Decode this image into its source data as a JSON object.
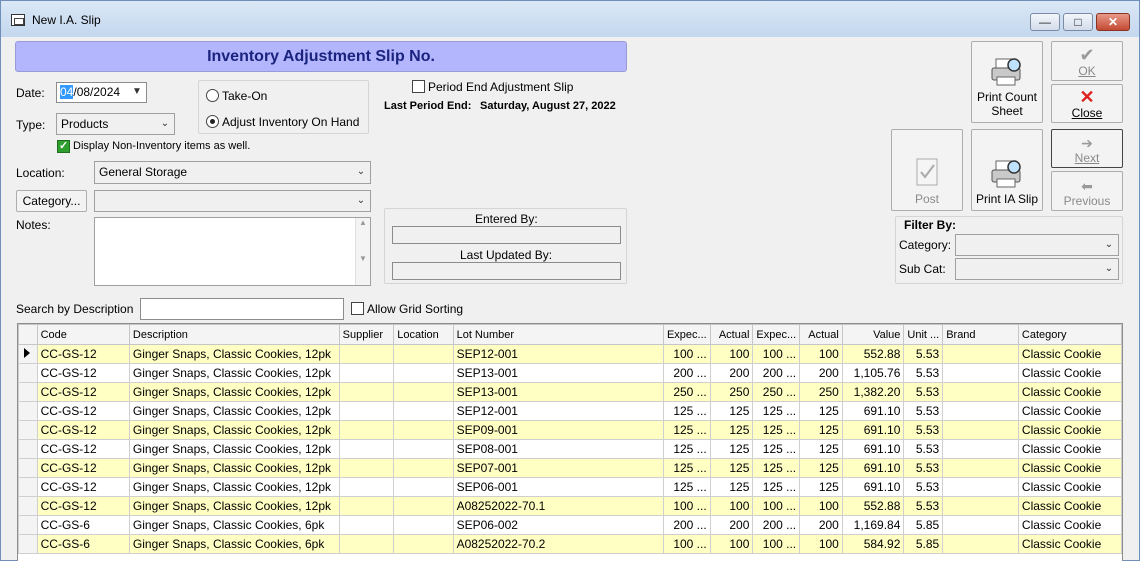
{
  "window": {
    "title": "New I.A. Slip"
  },
  "header": {
    "title": "Inventory Adjustment Slip No."
  },
  "form": {
    "date_label": "Date:",
    "date_selected": "04",
    "date_rest": "/08/2024",
    "type_label": "Type:",
    "type_value": "Products",
    "non_inventory_label": "Display Non-Inventory items as well.",
    "location_label": "Location:",
    "location_value": "General Storage",
    "category_button": "Category...",
    "category_value": "",
    "notes_label": "Notes:",
    "take_on_label": "Take-On",
    "adjust_label": "Adjust Inventory On Hand",
    "period_end_label": "Period End Adjustment Slip",
    "last_period_label": "Last Period End:",
    "last_period_value": "Saturday, August 27, 2022",
    "entered_by_label": "Entered By:",
    "entered_by_value": "",
    "last_updated_label": "Last Updated By:",
    "last_updated_value": "",
    "search_label": "Search by Description",
    "search_value": "",
    "allow_sorting_label": "Allow Grid Sorting"
  },
  "buttons": {
    "print_count": "Print Count Sheet",
    "ok": "OK",
    "close": "Close",
    "post": "Post",
    "print_ia": "Print IA Slip",
    "next": "Next",
    "previous": "Previous"
  },
  "filter": {
    "title": "Filter By:",
    "category_label": "Category:",
    "category_value": "",
    "subcat_label": "Sub Cat:",
    "subcat_value": ""
  },
  "grid": {
    "columns": [
      "Code",
      "Description",
      "Supplier",
      "Location",
      "Lot Number",
      "Expec...",
      "Actual",
      "Expec...",
      "Actual",
      "Value",
      "Unit ...",
      "Brand",
      "Category"
    ],
    "rows": [
      [
        "CC-GS-12",
        "Ginger Snaps, Classic Cookies, 12pk",
        "",
        "",
        "SEP12-001",
        "100 ...",
        "100",
        "100 ...",
        "100",
        "552.88",
        "5.53",
        "",
        "Classic Cookie"
      ],
      [
        "CC-GS-12",
        "Ginger Snaps, Classic Cookies, 12pk",
        "",
        "",
        "SEP13-001",
        "200 ...",
        "200",
        "200 ...",
        "200",
        "1,105.76",
        "5.53",
        "",
        "Classic Cookie"
      ],
      [
        "CC-GS-12",
        "Ginger Snaps, Classic Cookies, 12pk",
        "",
        "",
        "SEP13-001",
        "250 ...",
        "250",
        "250 ...",
        "250",
        "1,382.20",
        "5.53",
        "",
        "Classic Cookie"
      ],
      [
        "CC-GS-12",
        "Ginger Snaps, Classic Cookies, 12pk",
        "",
        "",
        "SEP12-001",
        "125 ...",
        "125",
        "125 ...",
        "125",
        "691.10",
        "5.53",
        "",
        "Classic Cookie"
      ],
      [
        "CC-GS-12",
        "Ginger Snaps, Classic Cookies, 12pk",
        "",
        "",
        "SEP09-001",
        "125 ...",
        "125",
        "125 ...",
        "125",
        "691.10",
        "5.53",
        "",
        "Classic Cookie"
      ],
      [
        "CC-GS-12",
        "Ginger Snaps, Classic Cookies, 12pk",
        "",
        "",
        "SEP08-001",
        "125 ...",
        "125",
        "125 ...",
        "125",
        "691.10",
        "5.53",
        "",
        "Classic Cookie"
      ],
      [
        "CC-GS-12",
        "Ginger Snaps, Classic Cookies, 12pk",
        "",
        "",
        "SEP07-001",
        "125 ...",
        "125",
        "125 ...",
        "125",
        "691.10",
        "5.53",
        "",
        "Classic Cookie"
      ],
      [
        "CC-GS-12",
        "Ginger Snaps, Classic Cookies, 12pk",
        "",
        "",
        "SEP06-001",
        "125 ...",
        "125",
        "125 ...",
        "125",
        "691.10",
        "5.53",
        "",
        "Classic Cookie"
      ],
      [
        "CC-GS-12",
        "Ginger Snaps, Classic Cookies, 12pk",
        "",
        "",
        "A08252022-70.1",
        "100 ...",
        "100",
        "100 ...",
        "100",
        "552.88",
        "5.53",
        "",
        "Classic Cookie"
      ],
      [
        "CC-GS-6",
        "Ginger Snaps, Classic Cookies, 6pk",
        "",
        "",
        "SEP06-002",
        "200 ...",
        "200",
        "200 ...",
        "200",
        "1,169.84",
        "5.85",
        "",
        "Classic Cookie"
      ],
      [
        "CC-GS-6",
        "Ginger Snaps, Classic Cookies, 6pk",
        "",
        "",
        "A08252022-70.2",
        "100 ...",
        "100",
        "100 ...",
        "100",
        "584.92",
        "5.85",
        "",
        "Classic Cookie"
      ]
    ]
  },
  "colors": {
    "header_bg": "#b4b6fd",
    "row_highlight": "#ffffc4",
    "title_text": "#1a237e"
  }
}
